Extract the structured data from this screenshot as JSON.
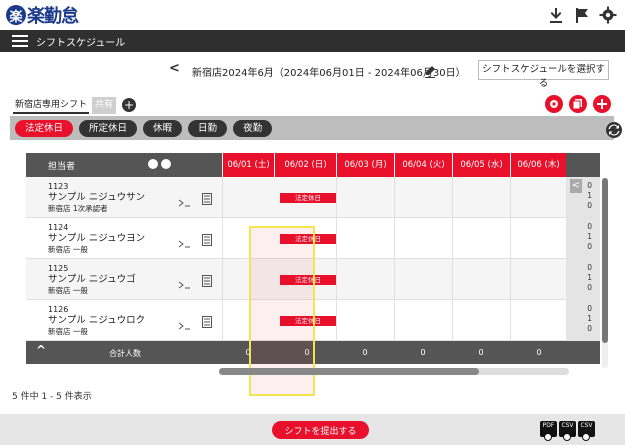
{
  "app": {
    "logo_mark": "楽",
    "logo_text": "楽勤怠"
  },
  "header_icons": [
    "download-icon",
    "flag-icon",
    "gear-icon"
  ],
  "menubar": {
    "title": "シフトスケジュール"
  },
  "period": {
    "prev": "<",
    "text": "新宿店2024年6月（2024年06月01日 - 2024年06月30日）",
    "select_button": "シフトスケジュールを選択する"
  },
  "tabs": [
    {
      "label": "新宿店専用シフト",
      "active": true
    },
    {
      "label": "共有",
      "active": false
    }
  ],
  "tab_add": "+",
  "filters": [
    {
      "label": "法定休日",
      "active": true
    },
    {
      "label": "所定休日",
      "active": false
    },
    {
      "label": "休暇",
      "active": false
    },
    {
      "label": "日勤",
      "active": false
    },
    {
      "label": "夜勤",
      "active": false
    }
  ],
  "grid": {
    "header_label": "担当者",
    "dates": [
      "06/01 (土)",
      "06/02 (日)",
      "06/03 (月)",
      "06/04 (火)",
      "06/05 (水)",
      "06/06 (木)"
    ],
    "employees": [
      {
        "id": "1123",
        "name": "サンプル ニジュウサン",
        "role": "新宿店 1次承認者",
        "badge": "法定休日",
        "counts": [
          "0",
          "1",
          "0"
        ]
      },
      {
        "id": "1124",
        "name": "サンプル ニジュウヨン",
        "role": "新宿店 一般",
        "badge": "法定休日",
        "counts": [
          "0",
          "1",
          "0"
        ]
      },
      {
        "id": "1125",
        "name": "サンプル ニジュウゴ",
        "role": "新宿店 一般",
        "badge": "法定休日",
        "counts": [
          "0",
          "1",
          "0"
        ]
      },
      {
        "id": "1126",
        "name": "サンプル ニジュウロク",
        "role": "新宿店 一般",
        "badge": "法定休日",
        "counts": [
          "0",
          "1",
          "0"
        ]
      }
    ],
    "footer": {
      "caret": "^",
      "label": "合計人数",
      "totals": [
        "0",
        "0",
        "0",
        "0",
        "0",
        "0"
      ]
    },
    "collapse": "<"
  },
  "count_text": "5 件中 1 - 5 件表示",
  "bottom": {
    "submit": "シフトを提出する",
    "exports": [
      "PDF",
      "CSV",
      "CSV"
    ]
  },
  "colors": {
    "accent": "#e8102a",
    "brand": "#1c3a8c",
    "highlight": "#f2e64a"
  }
}
